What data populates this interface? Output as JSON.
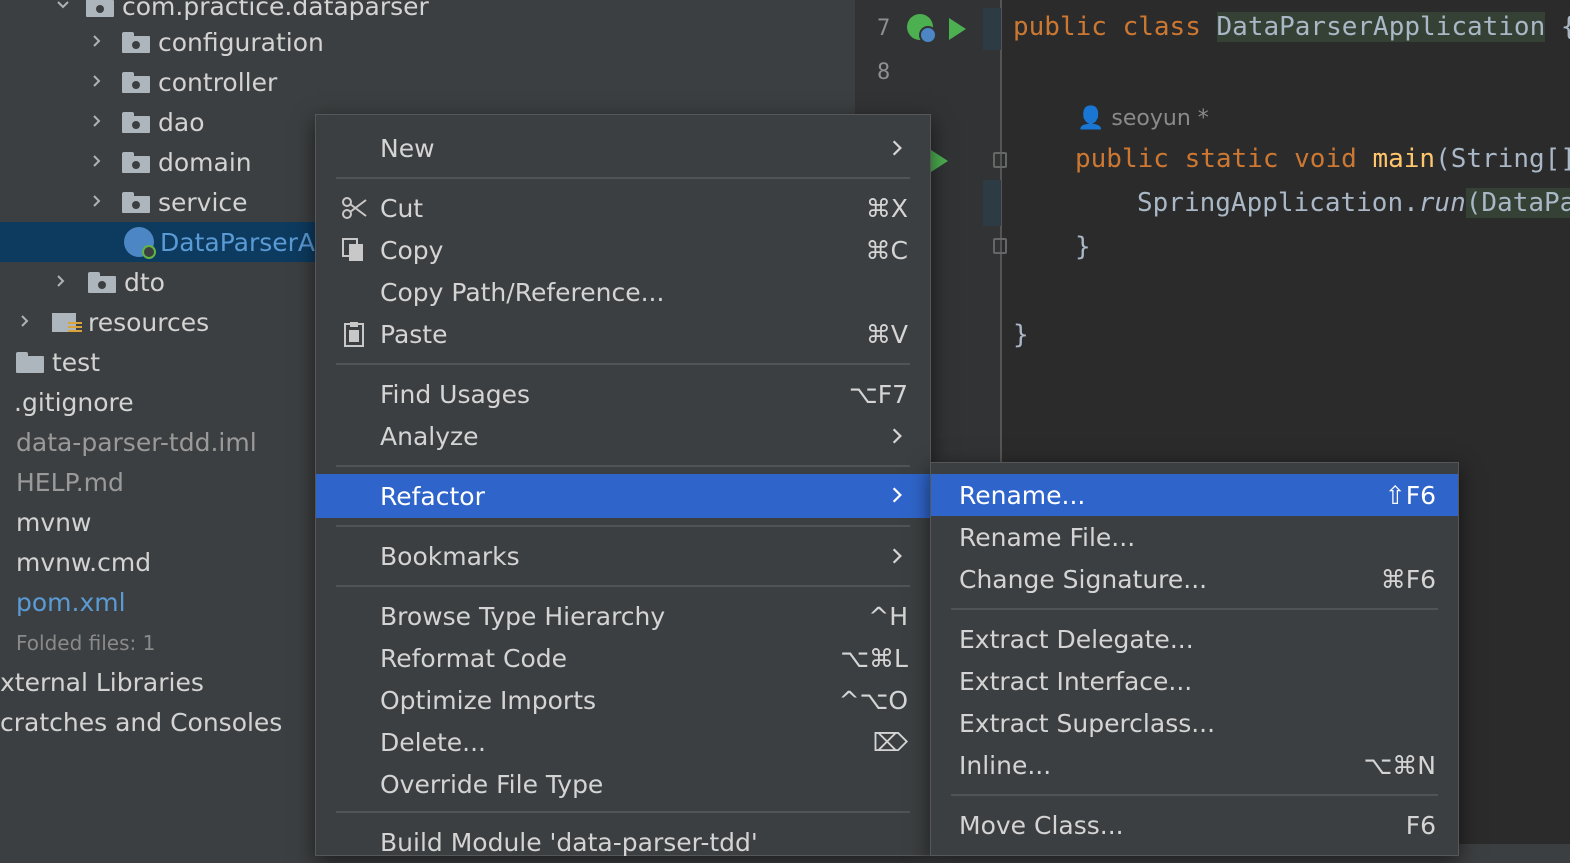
{
  "tree": {
    "package": "com.practice.dataparser",
    "folders": [
      "configuration",
      "controller",
      "dao",
      "domain",
      "service"
    ],
    "selected_file": "DataParserA",
    "dto": "dto",
    "resources": "resources",
    "test": "test",
    "gitignore": ".gitignore",
    "iml": "data-parser-tdd.iml",
    "help": "HELP.md",
    "mvnw": "mvnw",
    "mvnw_cmd": "mvnw.cmd",
    "pom": "pom.xml",
    "folded": "Folded files: 1",
    "external": "xternal Libraries",
    "scratches": "cratches and Consoles"
  },
  "editor": {
    "line7": "7",
    "line8": "8",
    "kw_public": "public",
    "kw_class": "class",
    "class_name": "DataParserApplication",
    "brace_open_cut": "{",
    "author": "seoyun *",
    "kw_static": "static",
    "kw_void": "void",
    "fn_main": "main",
    "main_args": "(String[]",
    "spring_app": "SpringApplication.",
    "run": "run",
    "run_args": "(DataPa",
    "close_brace": "}",
    "close_brace2": "}"
  },
  "context_menu": {
    "new": "New",
    "cut": "Cut",
    "cut_sc": "⌘X",
    "copy": "Copy",
    "copy_sc": "⌘C",
    "copy_path": "Copy Path/Reference...",
    "paste": "Paste",
    "paste_sc": "⌘V",
    "find_usages": "Find Usages",
    "find_usages_sc": "⌥F7",
    "analyze": "Analyze",
    "refactor": "Refactor",
    "bookmarks": "Bookmarks",
    "browse_hierarchy": "Browse Type Hierarchy",
    "browse_hierarchy_sc": "^H",
    "reformat": "Reformat Code",
    "reformat_sc": "⌥⌘L",
    "optimize": "Optimize Imports",
    "optimize_sc": "^⌥O",
    "delete": "Delete...",
    "delete_sc": "⌦",
    "override": "Override File Type",
    "build_module": "Build Module 'data-parser-tdd'"
  },
  "refactor_menu": {
    "rename": "Rename...",
    "rename_sc": "⇧F6",
    "rename_file": "Rename File...",
    "change_sig": "Change Signature...",
    "change_sig_sc": "⌘F6",
    "extract_delegate": "Extract Delegate...",
    "extract_interface": "Extract Interface...",
    "extract_superclass": "Extract Superclass...",
    "inline": "Inline...",
    "inline_sc": "⌥⌘N",
    "move_class": "Move Class...",
    "move_class_sc": "F6"
  },
  "colors": {
    "menu_bg": "#3c3f41",
    "selection": "#2f65ca",
    "tree_selection": "#0d3a5f",
    "editor_bg": "#2b2b2b"
  }
}
